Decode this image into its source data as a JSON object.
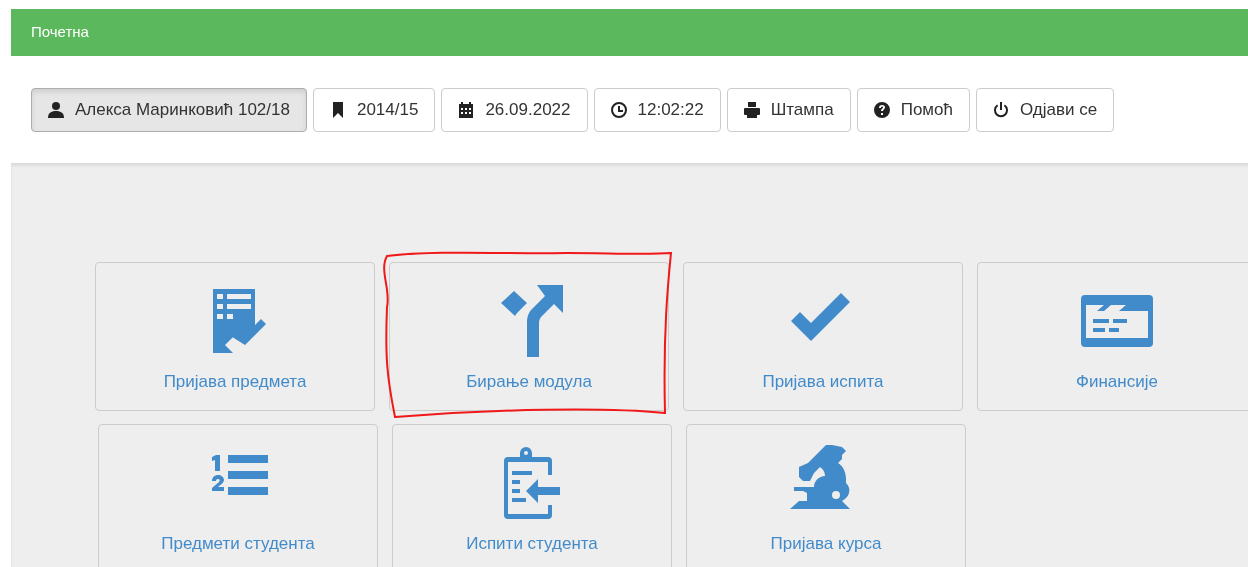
{
  "header": {
    "title": "Почетна"
  },
  "toolbar": [
    {
      "kind": "user",
      "label": "Алекса Маринковић 102/18",
      "selected": true
    },
    {
      "kind": "bookmark",
      "label": "2014/15",
      "selected": false
    },
    {
      "kind": "calendar",
      "label": "26.09.2022",
      "selected": false
    },
    {
      "kind": "clock",
      "label": "12:02:22",
      "selected": false
    },
    {
      "kind": "print",
      "label": "Штампа",
      "selected": false
    },
    {
      "kind": "help",
      "label": "Помоћ",
      "selected": false
    },
    {
      "kind": "power",
      "label": "Одјави се",
      "selected": false
    }
  ],
  "tiles": [
    [
      {
        "kind": "checklist",
        "label": "Пријава предмета",
        "annotated": false
      },
      {
        "kind": "fork",
        "label": "Бирање модула",
        "annotated": true
      },
      {
        "kind": "check",
        "label": "Пријава испита",
        "annotated": false
      },
      {
        "kind": "card",
        "label": "Финансије",
        "annotated": false
      }
    ],
    [
      {
        "kind": "numbered-list",
        "label": "Предмети студента",
        "annotated": false
      },
      {
        "kind": "clipboard",
        "label": "Испити студента",
        "annotated": false
      },
      {
        "kind": "microscope",
        "label": "Пријава курса",
        "annotated": false
      }
    ]
  ]
}
